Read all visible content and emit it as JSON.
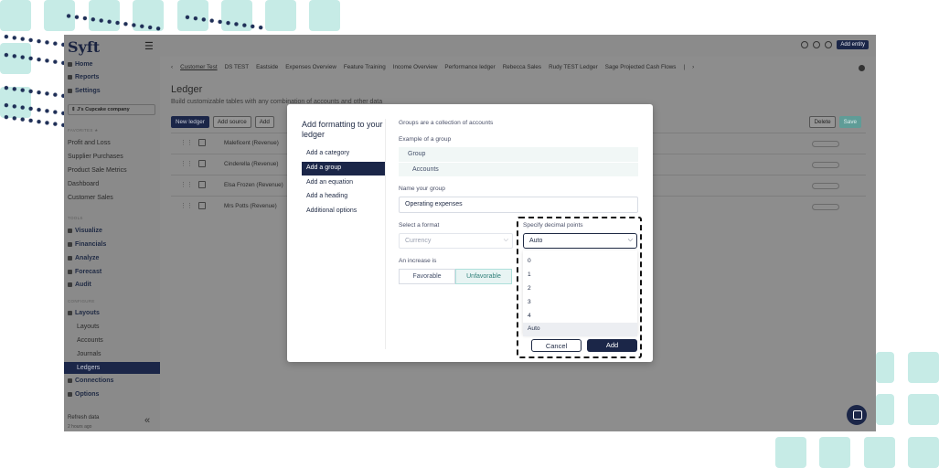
{
  "app": {
    "logo": "Syft",
    "add_entity": "Add entity"
  },
  "sidebar": {
    "top_items": [
      "Home",
      "Reports",
      "Settings"
    ],
    "company": "J's Cupcake company",
    "favorites_heading": "FAVORITES",
    "favorites": [
      "Profit and Loss",
      "Supplier Purchases",
      "Product Sale Metrics",
      "Dashboard",
      "Customer Sales"
    ],
    "tools_heading": "TOOLS",
    "tools": [
      "Visualize",
      "Financials",
      "Analyze",
      "Forecast",
      "Audit"
    ],
    "configure_heading": "CONFIGURE",
    "layouts": "Layouts",
    "layouts_sub": [
      "Layouts",
      "Accounts",
      "Journals"
    ],
    "active_item": "Ledgers",
    "connections": "Connections",
    "options": "Options",
    "refresh": "Refresh data",
    "refresh_sub": "2 hours ago"
  },
  "tabs": [
    "Customer Test",
    "DS TEST",
    "Eastside",
    "Expenses Overview",
    "Feature Training",
    "Income Overview",
    "Performance ledger",
    "Rebecca Sales",
    "Rudy TEST Ledger",
    "Sage Projected Cash Flows"
  ],
  "page": {
    "title": "Ledger",
    "subtitle": "Build customizable tables with any combination of accounts and other data",
    "buttons": [
      "New ledger",
      "Add source",
      "Add"
    ],
    "right_buttons": [
      "Delete",
      "Save"
    ]
  },
  "ledger_rows": [
    "Maleficent (Revenue)",
    "Cinderella (Revenue)",
    "Elsa Frozen (Revenue)",
    "Mrs Potts (Revenue)"
  ],
  "modal": {
    "title": "Add formatting to your ledger",
    "options": [
      "Add a category",
      "Add a group",
      "Add an equation",
      "Add a heading",
      "Additional options"
    ],
    "intro": "Groups are a collection of accounts",
    "example_label": "Example of a group",
    "example_group": "Group",
    "example_accounts": "Accounts",
    "name_label": "Name your group",
    "name_value": "Operating expenses",
    "format_label": "Select a format",
    "format_value": "Currency",
    "decimal_label": "Specify decimal points",
    "decimal_value": "Auto",
    "decimal_options": [
      "0",
      "1",
      "2",
      "3",
      "4",
      "Auto"
    ],
    "increase_label": "An increase is",
    "favorable": "Favorable",
    "unfavorable": "Unfavorable",
    "cancel": "Cancel",
    "add": "Add"
  },
  "colors": {
    "navy": "#1b2648",
    "teal_bg": "#c6ebe6",
    "overlay": "#8d8d8d"
  }
}
